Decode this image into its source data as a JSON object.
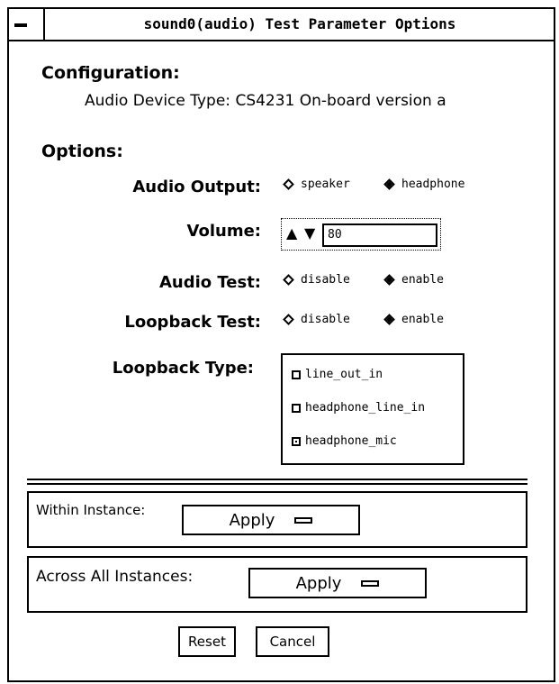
{
  "window": {
    "title": "sound0(audio) Test Parameter Options"
  },
  "configuration": {
    "heading": "Configuration:",
    "device_text": "Audio Device Type: CS4231 On-board version a"
  },
  "options": {
    "heading": "Options:",
    "audio_output": {
      "label": "Audio Output:",
      "choices": [
        "speaker",
        "headphone"
      ],
      "selected": "headphone"
    },
    "volume": {
      "label": "Volume:",
      "value": "80"
    },
    "audio_test": {
      "label": "Audio Test:",
      "choices": [
        "disable",
        "enable"
      ],
      "selected": "enable"
    },
    "loopback_test": {
      "label": "Loopback Test:",
      "choices": [
        "disable",
        "enable"
      ],
      "selected": "enable"
    },
    "loopback_type": {
      "label": "Loopback Type:",
      "items": [
        "line_out_in",
        "headphone_line_in",
        "headphone_mic"
      ],
      "checked": "headphone_mic"
    }
  },
  "within_instance": {
    "label": "Within Instance:",
    "button": "Apply"
  },
  "across_all_instances": {
    "label": "Across All Instances:",
    "button": "Apply"
  },
  "buttons": {
    "reset": "Reset",
    "cancel": "Cancel"
  }
}
